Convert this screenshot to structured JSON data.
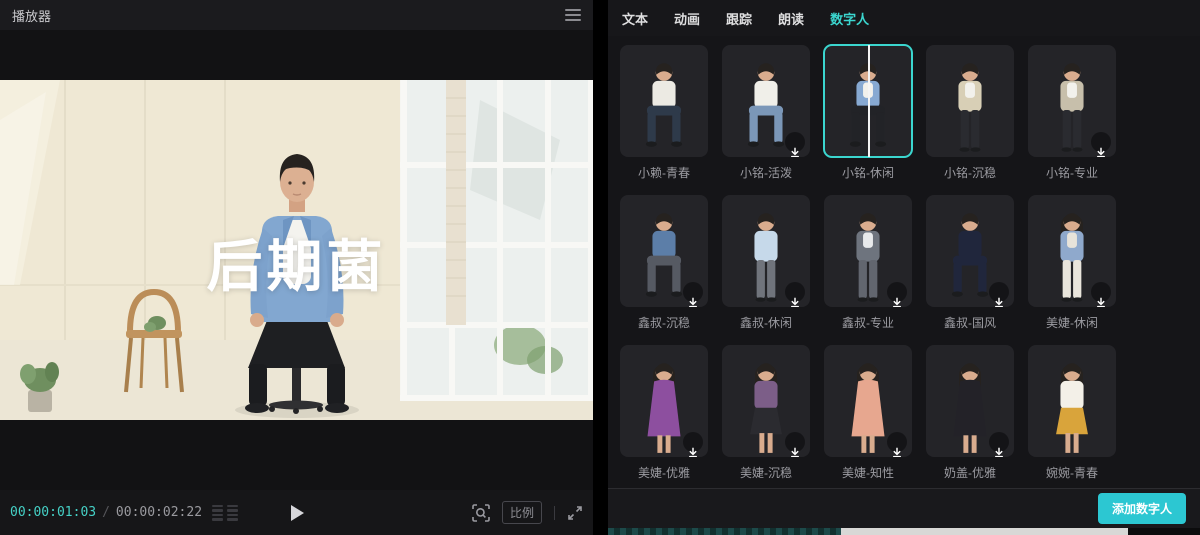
{
  "colors": {
    "accent": "#3bd6cf",
    "add_button_bg": "#2cc7d2",
    "selected_border": "#3bd6cf",
    "timecode_current": "#45d1c6"
  },
  "icons": {
    "menu": "hamburger-three-lines",
    "segment_list": "double-column-list",
    "play": "triangle-right",
    "preview_zoom": "magnifier-in-corner-brackets",
    "fullscreen": "expand-arrows",
    "download": "arrow-down-to-line"
  },
  "player": {
    "title": "播放器",
    "overlay_text": "后期菌",
    "current_time": "00:00:01:03",
    "time_separator": "/",
    "total_time": "00:00:02:22",
    "ratio_label": "比例"
  },
  "right_panel": {
    "tabs": [
      {
        "id": "tab-text",
        "label": "文本",
        "active": false
      },
      {
        "id": "tab-animation",
        "label": "动画",
        "active": false
      },
      {
        "id": "tab-tracking",
        "label": "跟踪",
        "active": false
      },
      {
        "id": "tab-read-aloud",
        "label": "朗读",
        "active": false
      },
      {
        "id": "tab-digital-human",
        "label": "数字人",
        "active": true
      }
    ],
    "add_button_label": "添加数字人",
    "avatars": [
      {
        "name": "小赖-青春",
        "selected": false,
        "downloadable": false,
        "pose": "sit",
        "hair": "short",
        "bottom": "pants",
        "top": "#eceae3",
        "under": "",
        "pants": "#2e3a4a"
      },
      {
        "name": "小铭-活泼",
        "selected": false,
        "downloadable": true,
        "pose": "sit",
        "hair": "short",
        "bottom": "pants",
        "top": "#f0efe9",
        "under": "",
        "pants": "#7b97b8"
      },
      {
        "name": "小铭-休闲",
        "selected": true,
        "downloadable": false,
        "pose": "sit",
        "hair": "short",
        "bottom": "pants",
        "top": "#87a9d2",
        "under": "#f2f1ec",
        "pants": "#222327"
      },
      {
        "name": "小铭-沉稳",
        "selected": false,
        "downloadable": false,
        "pose": "stand",
        "hair": "short",
        "bottom": "pants",
        "top": "#d8cfb6",
        "under": "#f2f1ec",
        "pants": "#2a2b30"
      },
      {
        "name": "小铭-专业",
        "selected": false,
        "downloadable": true,
        "pose": "stand",
        "hair": "short",
        "bottom": "pants",
        "top": "#c7bfab",
        "under": "#f2f1ec",
        "pants": "#2a2b30"
      },
      {
        "name": "鑫叔-沉稳",
        "selected": false,
        "downloadable": true,
        "pose": "sit",
        "hair": "short",
        "bottom": "pants",
        "top": "#5c7ea8",
        "under": "",
        "pants": "#565a63"
      },
      {
        "name": "鑫叔-休闲",
        "selected": false,
        "downloadable": true,
        "pose": "stand",
        "hair": "short",
        "bottom": "pants",
        "top": "#c6d9ea",
        "under": "",
        "pants": "#70747c"
      },
      {
        "name": "鑫叔-专业",
        "selected": false,
        "downloadable": true,
        "pose": "stand",
        "hair": "short",
        "bottom": "pants",
        "top": "#6e747e",
        "under": "#e8eaec",
        "pants": "#62666f"
      },
      {
        "name": "鑫叔-国风",
        "selected": false,
        "downloadable": true,
        "pose": "sit",
        "hair": "short",
        "bottom": "pants",
        "top": "#20263c",
        "under": "",
        "pants": "#20263c"
      },
      {
        "name": "美婕-休闲",
        "selected": false,
        "downloadable": true,
        "pose": "stand",
        "hair": "long",
        "bottom": "pants",
        "top": "#8fa9cc",
        "under": "#e7e3da",
        "pants": "#e9e5dc"
      },
      {
        "name": "美婕-优雅",
        "selected": false,
        "downloadable": true,
        "pose": "stand",
        "hair": "long",
        "bottom": "dress",
        "top": "#8d4f9f",
        "under": "",
        "pants": "#8d4f9f"
      },
      {
        "name": "美婕-沉稳",
        "selected": false,
        "downloadable": true,
        "pose": "stand",
        "hair": "long",
        "bottom": "skirt",
        "top": "#7c5e88",
        "under": "",
        "pants": "#2b2b30"
      },
      {
        "name": "美婕-知性",
        "selected": false,
        "downloadable": true,
        "pose": "stand",
        "hair": "long",
        "bottom": "dress",
        "top": "#e7a78f",
        "under": "",
        "pants": "#e0b4a2"
      },
      {
        "name": "奶盖-优雅",
        "selected": false,
        "downloadable": true,
        "pose": "stand",
        "hair": "long",
        "bottom": "dress",
        "top": "#232228",
        "under": "",
        "pants": "#232228"
      },
      {
        "name": "婉婉-青春",
        "selected": false,
        "downloadable": false,
        "pose": "stand",
        "hair": "long",
        "bottom": "skirt",
        "top": "#f3f0e8",
        "under": "",
        "pants": "#d9a43b"
      }
    ]
  }
}
